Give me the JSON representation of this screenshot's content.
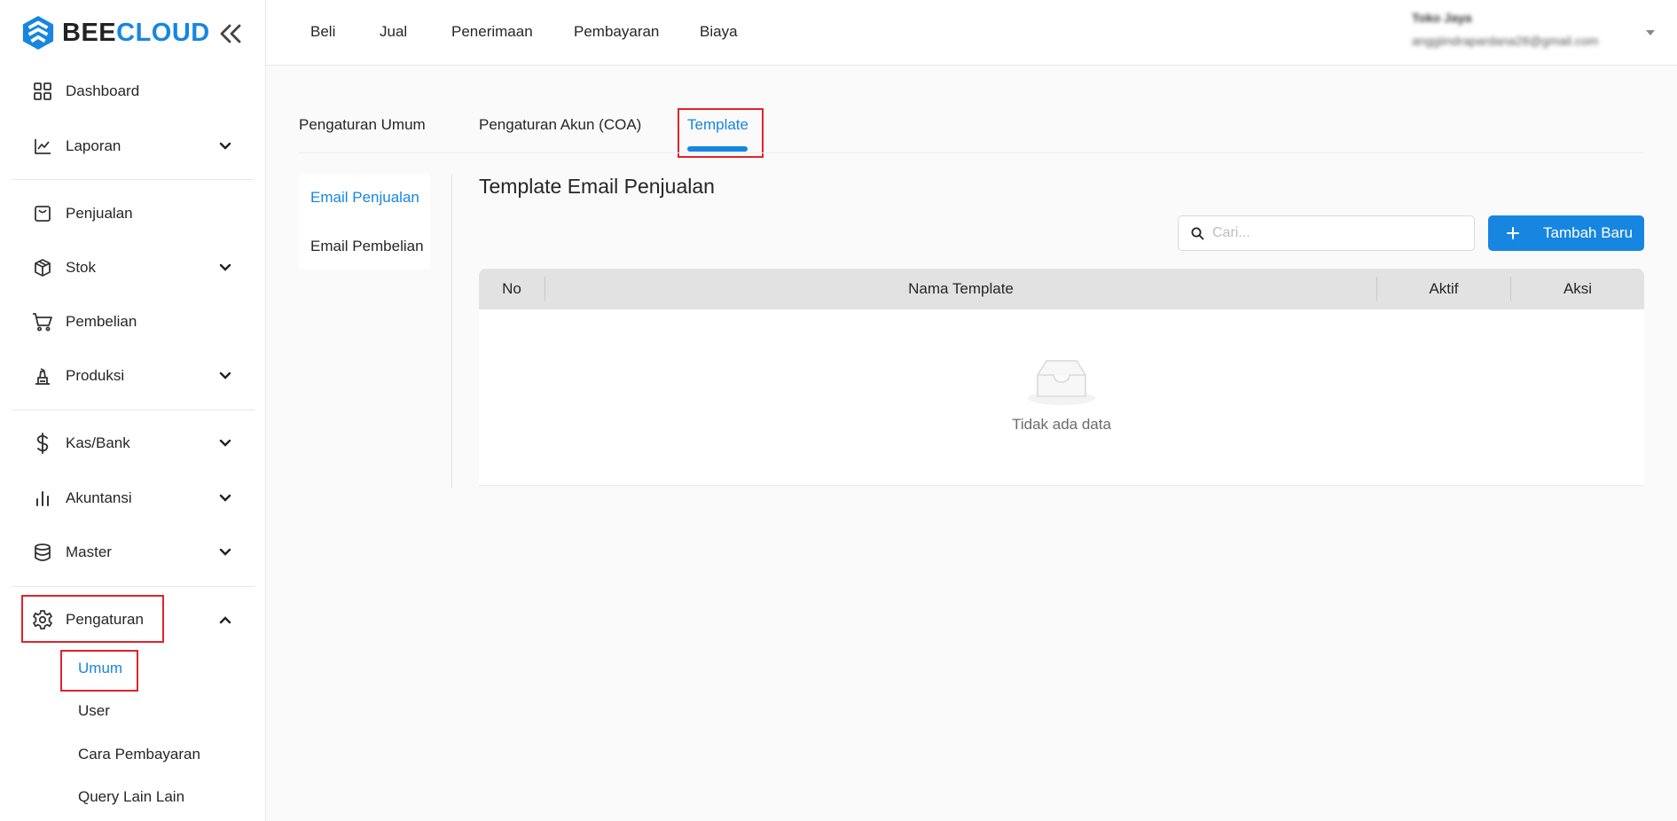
{
  "brand": {
    "name_part1": "BEE",
    "name_part2": "CLOUD",
    "accent": "#1786e0"
  },
  "sidebar": {
    "items": [
      {
        "label": "Dashboard",
        "icon": "dashboard-grid-icon"
      },
      {
        "label": "Laporan",
        "icon": "line-chart-icon",
        "expandable": true
      },
      {
        "label": "Penjualan",
        "icon": "shopping-bag-icon"
      },
      {
        "label": "Stok",
        "icon": "box-icon",
        "expandable": true
      },
      {
        "label": "Pembelian",
        "icon": "cart-icon"
      },
      {
        "label": "Produksi",
        "icon": "production-icon",
        "expandable": true
      },
      {
        "label": "Kas/Bank",
        "icon": "dollar-icon",
        "expandable": true
      },
      {
        "label": "Akuntansi",
        "icon": "bar-chart-icon",
        "expandable": true
      },
      {
        "label": "Master",
        "icon": "database-icon",
        "expandable": true
      },
      {
        "label": "Pengaturan",
        "icon": "gear-icon",
        "expandable": true,
        "expanded": true
      }
    ],
    "sub_items": [
      {
        "label": "Umum",
        "active": true
      },
      {
        "label": "User"
      },
      {
        "label": "Cara Pembayaran"
      },
      {
        "label": "Query Lain Lain"
      }
    ]
  },
  "topnav": [
    "Beli",
    "Jual",
    "Penerimaan",
    "Pembayaran",
    "Biaya"
  ],
  "user": {
    "name": "Toko Jaya",
    "email": "anggiindrapardana28@gmail.com"
  },
  "tabs": [
    {
      "label": "Pengaturan Umum"
    },
    {
      "label": "Pengaturan Akun (COA)"
    },
    {
      "label": "Template",
      "active": true
    }
  ],
  "submenu": [
    {
      "label": "Email Penjualan",
      "active": true
    },
    {
      "label": "Email Pembelian"
    }
  ],
  "content": {
    "title": "Template Email Penjualan",
    "search_placeholder": "Cari...",
    "add_button": "Tambah Baru",
    "table": {
      "columns": [
        "No",
        "Nama Template",
        "Aktif",
        "Aksi"
      ],
      "rows": [],
      "empty_text": "Tidak ada data"
    }
  }
}
